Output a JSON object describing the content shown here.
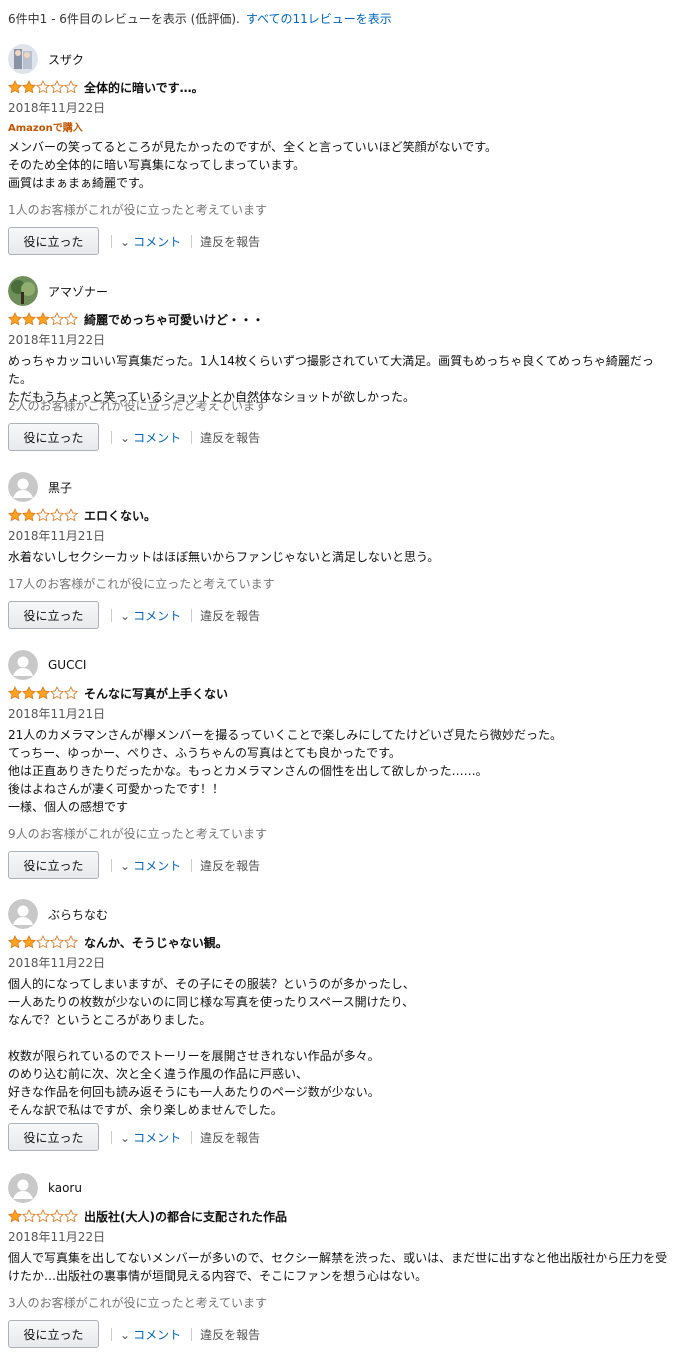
{
  "header": {
    "summary": "6件中1 - 6件目のレビューを表示 (低評価).",
    "all_reviews_link": "すべての11レビューを表示"
  },
  "colors": {
    "star": "#ffa41c",
    "star_outline": "#de7921",
    "link": "#0066c0",
    "badge": "#c45500"
  },
  "actions": {
    "helpful_button": "役に立った",
    "comment": "コメント",
    "report": "違反を報告"
  },
  "reviews": [
    {
      "author": "スザク",
      "avatar": "photo-avatar",
      "rating": 2,
      "title": "全体的に暗いです…。",
      "date": "2018年11月22日",
      "badge": "Amazonで購入",
      "body": "メンバーの笑ってるところが見たかったのですが、全くと言っていいほど笑顔がないです。\nそのため全体的に暗い写真集になってしまっています。\n画質はまぁまぁ綺麗です。",
      "helpful": "1人のお客様がこれが役に立ったと考えています"
    },
    {
      "author": "アマゾナー",
      "avatar": "tree-avatar",
      "rating": 3,
      "title": "綺麗でめっちゃ可愛いけど・・・",
      "date": "2018年11月22日",
      "badge": "",
      "body": "めっちゃカッコいい写真集だった。1人14枚くらいずつ撮影されていて大満足。画質もめっちゃ良くてめっちゃ綺麗だった。\nただもうちょっと笑っているショットとか自然体なショットが欲しかった。",
      "helpful": "2人のお客様がこれが役に立ったと考えています"
    },
    {
      "author": "黒子",
      "avatar": "default-avatar",
      "rating": 2,
      "title": "エロくない。",
      "date": "2018年11月21日",
      "badge": "",
      "body": "水着ないしセクシーカットはほぼ無いからファンじゃないと満足しないと思う。",
      "helpful": "17人のお客様がこれが役に立ったと考えています"
    },
    {
      "author": "GUCCI",
      "avatar": "default-avatar",
      "rating": 3,
      "title": "そんなに写真が上手くない",
      "date": "2018年11月21日",
      "badge": "",
      "body": "21人のカメラマンさんが欅メンバーを撮るっていくことで楽しみにしてたけどいざ見たら微妙だった。\nてっちー、ゆっかー、ぺりさ、ふうちゃんの写真はとても良かったです。\n他は正直ありきたりだったかな。もっとカメラマンさんの個性を出して欲しかった……。\n後はよねさんが凄く可愛かったです！！\n一様、個人の感想です",
      "helpful": "9人のお客様がこれが役に立ったと考えています"
    },
    {
      "author": "ぶらちなむ",
      "avatar": "default-avatar",
      "rating": 2,
      "title": "なんか、そうじゃない観。",
      "date": "2018年11月22日",
      "badge": "",
      "body": "個人的になってしまいますが、その子にその服装？というのが多かったし、\n一人あたりの枚数が少ないのに同じ様な写真を使ったりスペース開けたり、\nなんで？というところがありました。\n\n枚数が限られているのでストーリーを展開させきれない作品が多々。\nのめり込む前に次、次と全く違う作風の作品に戸惑い、\n好きな作品を何回も読み返そうにも一人あたりのページ数が少ない。\nそんな訳で私はですが、余り楽しめませんでした。",
      "helpful": ""
    },
    {
      "author": "kaoru",
      "avatar": "default-avatar",
      "rating": 1,
      "title": "出版社(大人)の都合に支配された作品",
      "date": "2018年11月22日",
      "badge": "",
      "body": "個人で写真集を出してないメンバーが多いので、セクシー解禁を渋った、或いは、まだ世に出すなと他出版社から圧力を受けたか…出版社の裏事情が垣間見える内容で、そこにファンを想う心はない。",
      "helpful": "3人のお客様がこれが役に立ったと考えています"
    }
  ]
}
